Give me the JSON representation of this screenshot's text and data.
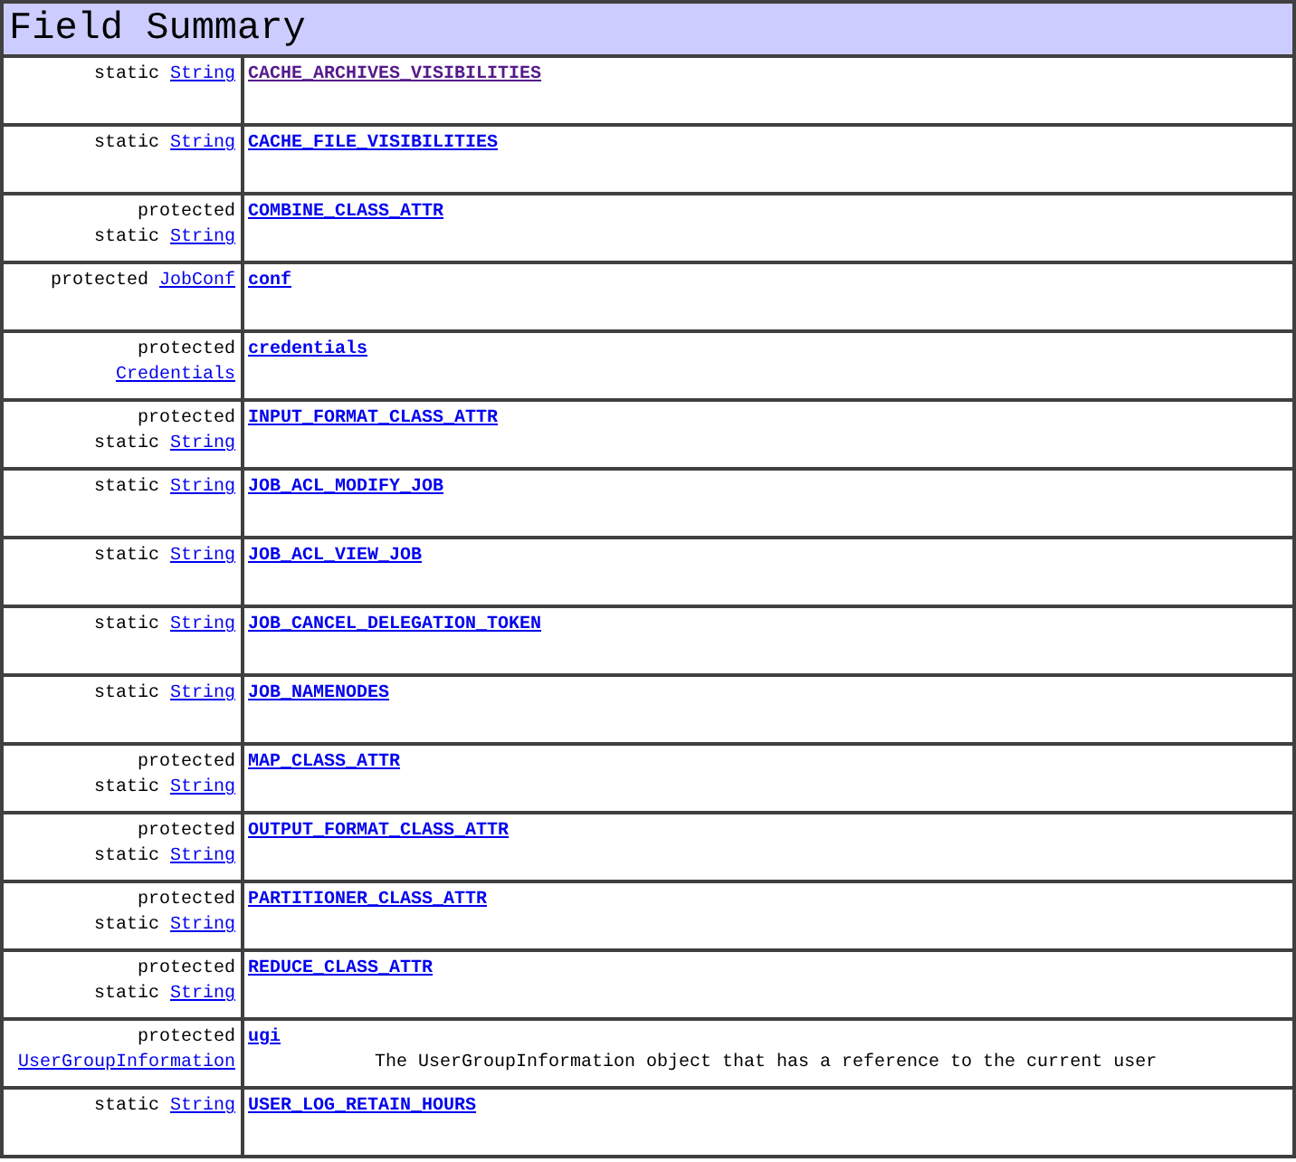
{
  "title": "Field Summary",
  "fields": [
    {
      "modifiers": [
        "static"
      ],
      "type": "String",
      "name": "CACHE_ARCHIVES_VISIBILITIES",
      "visited": true
    },
    {
      "modifiers": [
        "static"
      ],
      "type": "String",
      "name": "CACHE_FILE_VISIBILITIES",
      "visited": false
    },
    {
      "modifiers": [
        "protected",
        "static"
      ],
      "type": "String",
      "name": "COMBINE_CLASS_ATTR",
      "visited": false
    },
    {
      "modifiers": [
        "protected"
      ],
      "type": "JobConf",
      "name": "conf",
      "visited": false
    },
    {
      "modifiers": [
        "protected"
      ],
      "type": "Credentials",
      "name": "credentials",
      "visited": false
    },
    {
      "modifiers": [
        "protected",
        "static"
      ],
      "type": "String",
      "name": "INPUT_FORMAT_CLASS_ATTR",
      "visited": false
    },
    {
      "modifiers": [
        "static"
      ],
      "type": "String",
      "name": "JOB_ACL_MODIFY_JOB",
      "visited": false
    },
    {
      "modifiers": [
        "static"
      ],
      "type": "String",
      "name": "JOB_ACL_VIEW_JOB",
      "visited": false
    },
    {
      "modifiers": [
        "static"
      ],
      "type": "String",
      "name": "JOB_CANCEL_DELEGATION_TOKEN",
      "visited": false
    },
    {
      "modifiers": [
        "static"
      ],
      "type": "String",
      "name": "JOB_NAMENODES",
      "visited": false
    },
    {
      "modifiers": [
        "protected",
        "static"
      ],
      "type": "String",
      "name": "MAP_CLASS_ATTR",
      "visited": false
    },
    {
      "modifiers": [
        "protected",
        "static"
      ],
      "type": "String",
      "name": "OUTPUT_FORMAT_CLASS_ATTR",
      "visited": false
    },
    {
      "modifiers": [
        "protected",
        "static"
      ],
      "type": "String",
      "name": "PARTITIONER_CLASS_ATTR",
      "visited": false
    },
    {
      "modifiers": [
        "protected",
        "static"
      ],
      "type": "String",
      "name": "REDUCE_CLASS_ATTR",
      "visited": false
    },
    {
      "modifiers": [
        "protected"
      ],
      "type": "UserGroupInformation",
      "name": "ugi",
      "visited": false,
      "description": "The UserGroupInformation object that has a reference to the current user"
    },
    {
      "modifiers": [
        "static"
      ],
      "type": "String",
      "name": "USER_LOG_RETAIN_HOURS",
      "visited": false
    }
  ]
}
